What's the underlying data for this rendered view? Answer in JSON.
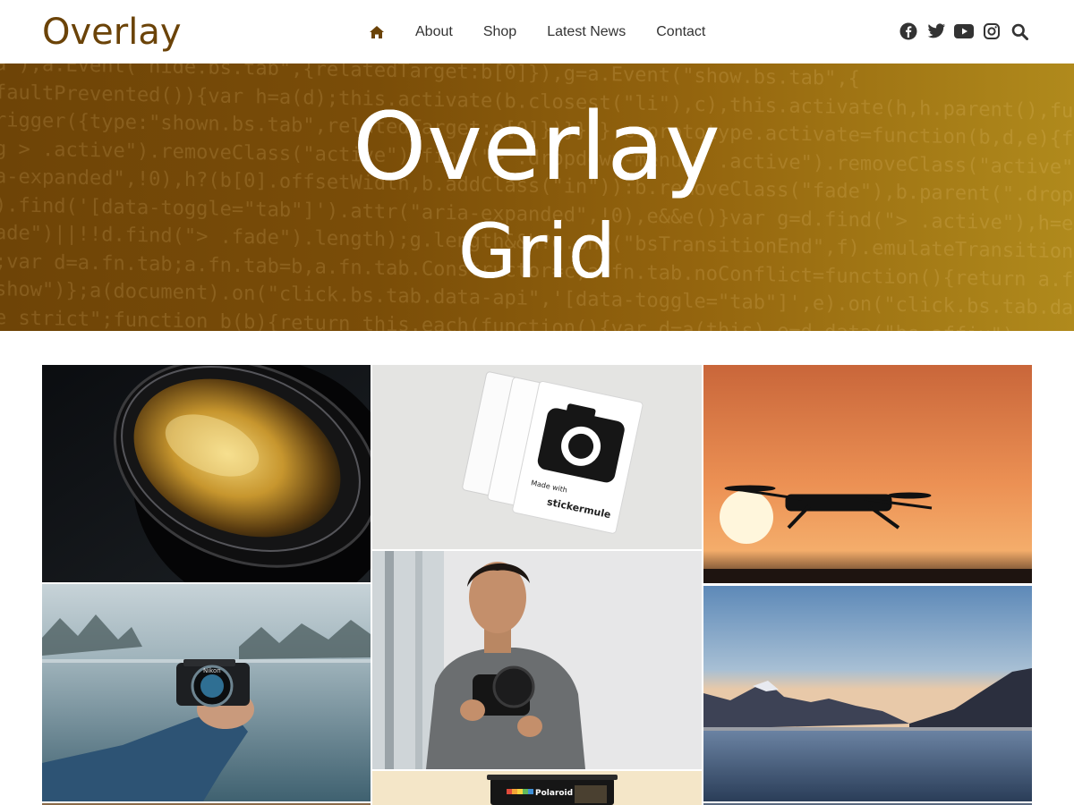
{
  "site": {
    "logo": "Overlay",
    "brand_color": "#6b4308"
  },
  "nav": {
    "home_icon": "home-icon",
    "items": [
      {
        "label": "About"
      },
      {
        "label": "Shop"
      },
      {
        "label": "Latest News"
      },
      {
        "label": "Contact"
      }
    ]
  },
  "social": {
    "icons": [
      "facebook-icon",
      "twitter-icon",
      "youtube-icon",
      "instagram-icon",
      "search-icon"
    ]
  },
  "hero": {
    "title_line1": "Overlay",
    "title_line2": "Grid",
    "code_lines": [
      "a\"),a.Event(\"hide.bs.tab\",{relatedTarget:b[0]}),g=a.Event(\"show.bs.tab\",{",
      "faultPrevented()){var h=a(d);this.activate(b.closest(\"li\"),c),this.activate(h,h.parent(),function",
      "rigger({type:\"shown.bs.tab\",relatedTarget:e[0]})}}}},c.prototype.activate=function(b,d,e){func",
      "g > .active\").removeClass(\"active\").find(\"> .dropdown-menu > .active\").removeClass(\"active\").end().find(",
      "a-expanded\",!0),h?(b[0].offsetWidth,b.addClass(\"in\")):b.removeClass(\"fade\"),b.parent(\".dropdo",
      ").find('[data-toggle=\"tab\"]').attr(\"aria-expanded\",!0),e&&e()}var g=d.find(\"> .active\"),h=e&&",
      "ade\")||!!d.find(\"> .fade\").length);g.length&&h?g.one(\"bsTransitionEnd\",f).emulateTransitionEnd",
      ";var d=a.fn.tab;a.fn.tab=b,a.fn.tab.Constructor=c,a.fn.tab.noConflict=function(){return a.fn.t",
      "show\")};a(document).on(\"click.bs.tab.data-api\",'[data-toggle=\"tab\"]',e).on(\"click.bs.tab.data",
      "e strict\";function b(b){return this.each(function(){var d=a(this),e=d.data(\"bs.affix\")"
    ]
  },
  "grid": {
    "tiles": [
      {
        "id": "camera-lens"
      },
      {
        "id": "camera-stickers",
        "sticker_text": "Made with",
        "sticker_brand": "stickermule"
      },
      {
        "id": "drone-sunset"
      },
      {
        "id": "camera-hand-lake",
        "camera_brand": "Nikon"
      },
      {
        "id": "man-with-camera"
      },
      {
        "id": "mountain-lake"
      },
      {
        "id": "polaroid-camera",
        "camera_brand": "Polaroid"
      }
    ]
  }
}
